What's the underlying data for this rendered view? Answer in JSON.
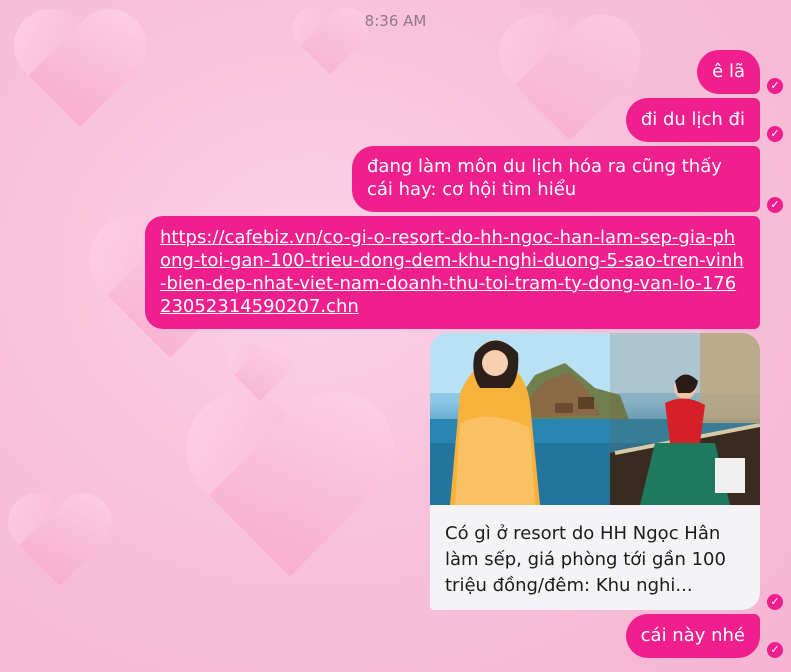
{
  "conversation": {
    "timestamp": "8:36 AM",
    "messages": [
      {
        "text": "ê lã"
      },
      {
        "text": "đi du lịch đi"
      },
      {
        "text": "đang làm môn du lịch hóa ra cũng thấy cái hay: cơ hội tìm hiểu"
      },
      {
        "link": "https://cafebiz.vn/co-gi-o-resort-do-hh-ngoc-han-lam-sep-gia-phong-toi-gan-100-trieu-dong-dem-khu-nghi-duong-5-sao-tren-vinh-bien-dep-nhat-viet-nam-doanh-thu-toi-tram-ty-dong-van-lo-17623052314590207.chn"
      },
      {
        "preview_title": "Có gì ở resort do HH Ngọc Hân làm sếp, giá phòng tới gần 100 triệu đồng/đêm: Khu nghi..."
      },
      {
        "text": "cái này nhé"
      }
    ]
  },
  "status_icon": "seen-check-icon",
  "colors": {
    "bubble": "#ef1f8d",
    "background": "#f8c2da",
    "card": "#f4f4f6"
  }
}
